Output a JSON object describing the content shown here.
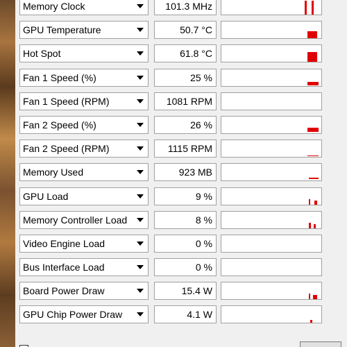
{
  "sensors": [
    {
      "name": "Memory Clock",
      "value": "101.3 MHz",
      "graph_level": 1.0
    },
    {
      "name": "GPU Temperature",
      "value": "50.7 °C",
      "graph_level": 0.3
    },
    {
      "name": "Hot Spot",
      "value": "61.8 °C",
      "graph_level": 0.45
    },
    {
      "name": "Fan 1 Speed (%)",
      "value": "25 %",
      "graph_level": 0.25
    },
    {
      "name": "Fan 1 Speed (RPM)",
      "value": "1081 RPM",
      "graph_level": 0.0
    },
    {
      "name": "Fan 2 Speed (%)",
      "value": "26 %",
      "graph_level": 0.26
    },
    {
      "name": "Fan 2 Speed (RPM)",
      "value": "1115 RPM",
      "graph_level": 0.0
    },
    {
      "name": "Memory Used",
      "value": "923 MB",
      "graph_level": 0.1
    },
    {
      "name": "GPU Load",
      "value": "9 %",
      "graph_level": 0.09
    },
    {
      "name": "Memory Controller Load",
      "value": "8 %",
      "graph_level": 0.08
    },
    {
      "name": "Video Engine Load",
      "value": "0 %",
      "graph_level": 0.0
    },
    {
      "name": "Bus Interface Load",
      "value": "0 %",
      "graph_level": 0.0
    },
    {
      "name": "Board Power Draw",
      "value": "15.4 W",
      "graph_level": 0.15
    },
    {
      "name": "GPU Chip Power Draw",
      "value": "4.1 W",
      "graph_level": 0.05
    }
  ],
  "colors": {
    "graph": "#e00000",
    "field_border": "#a0a0a0",
    "panel": "#f0f0f0"
  },
  "icons": {
    "dropdown": "chevron-down-icon"
  }
}
